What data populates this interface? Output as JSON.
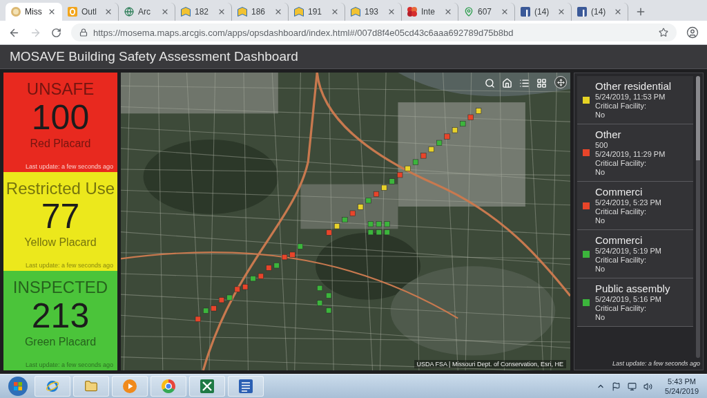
{
  "browser": {
    "tabs": [
      {
        "title": "Miss",
        "kind": "badge",
        "selected": true
      },
      {
        "title": "Outl",
        "kind": "mail",
        "selected": false
      },
      {
        "title": "Arc",
        "kind": "globe",
        "selected": false
      },
      {
        "title": "182",
        "kind": "map",
        "selected": false
      },
      {
        "title": "186",
        "kind": "map",
        "selected": false
      },
      {
        "title": "191",
        "kind": "map",
        "selected": false
      },
      {
        "title": "193",
        "kind": "map",
        "selected": false
      },
      {
        "title": "Inte",
        "kind": "logo",
        "selected": false
      },
      {
        "title": "607",
        "kind": "pin",
        "selected": false
      },
      {
        "title": "(14)",
        "kind": "social",
        "selected": false
      },
      {
        "title": "(14)",
        "kind": "social",
        "selected": false
      }
    ],
    "navigation": {
      "back_disabled": false,
      "forward_disabled": true
    },
    "address_bar": {
      "url": "https://mosema.maps.arcgis.com/apps/opsdashboard/index.html#/007d8f4e05cd43c6aaa692789d75b8bd"
    }
  },
  "dashboard": {
    "title": "MOSAVE Building Safety Assessment Dashboard",
    "indicators": [
      {
        "label": "UNSAFE",
        "value": "100",
        "caption": "Red Placard",
        "footer": "Last update: a few seconds ago",
        "color": "#e8291f"
      },
      {
        "label": "Restricted Use",
        "value": "77",
        "caption": "Yellow Placard",
        "footer": "Last update: a few seconds ago",
        "color": "#ece81c"
      },
      {
        "label": "INSPECTED",
        "value": "213",
        "caption": "Green Placard",
        "footer": "Last update: a few seconds ago",
        "color": "#4bc43a"
      }
    ],
    "map": {
      "attribution": "USDA FSA | Missouri Dept. of Conservation, Esri, HE"
    },
    "list": {
      "items": [
        {
          "title": "Other residential",
          "date": "5/24/2019, 11:53 PM",
          "facility_label": "Critical Facility:",
          "facility_value": "No",
          "color": "#e6d324"
        },
        {
          "title": "Other",
          "address": "500",
          "date": "5/24/2019, 11:29 PM",
          "facility_label": "Critical Facility:",
          "facility_value": "No",
          "color": "#e8452a"
        },
        {
          "title": "Commerci",
          "date": "5/24/2019, 5:23 PM",
          "facility_label": "Critical Facility:",
          "facility_value": "No",
          "color": "#e8452a"
        },
        {
          "title": "Commerci",
          "date": "5/24/2019, 5:19 PM",
          "facility_label": "Critical Facility:",
          "facility_value": "No",
          "color": "#3cb53c"
        },
        {
          "title": "Public assembly",
          "date": "5/24/2019, 5:16 PM",
          "facility_label": "Critical Facility:",
          "facility_value": "No",
          "color": "#3cb53c"
        }
      ],
      "footer": "Last update: a few seconds ago"
    }
  },
  "taskbar": {
    "time": "5:43 PM",
    "date": "5/24/2019"
  }
}
